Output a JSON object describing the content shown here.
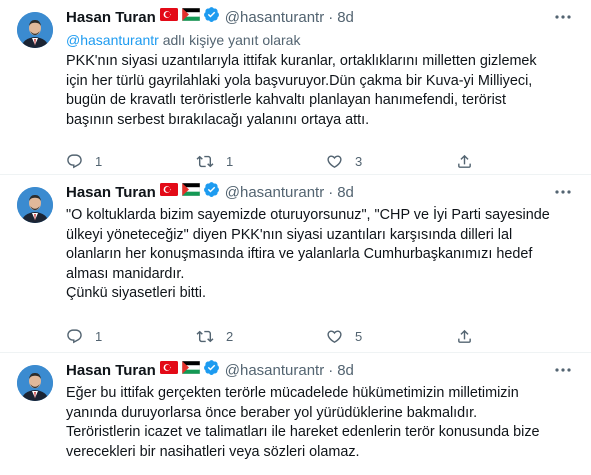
{
  "tweets": [
    {
      "name": "Hasan Turan",
      "handle": "@hasanturantr",
      "time": "8d",
      "reply_to_mention": "@hasanturantr",
      "reply_to_suffix": " adlı kişiye yanıt olarak",
      "text_lines": [
        "PKK'nın siyasi uzantılarıyla ittifak kuranlar, ortaklıklarını milletten gizlemek",
        "için her türlü gayrilahlaki yola başvuruyor.Dün çakma bir Kuva-yi Milliyeci,",
        "bugün de kravatlı teröristlerle kahvaltı planlayan hanımefendi, terörist",
        "başının serbest bırakılacağı yalanını ortaya attı."
      ],
      "replies": "1",
      "retweets": "1",
      "likes": "3"
    },
    {
      "name": "Hasan Turan",
      "handle": "@hasanturantr",
      "time": "8d",
      "text_lines": [
        "\"O koltuklarda bizim sayemizde oturuyorsunuz\", \"CHP ve İyi Parti sayesinde",
        "ülkeyi yöneteceğiz\" diyen PKK'nın siyasi uzantıları karşısında dilleri lal",
        "olanların her konuşmasında iftira ve yalanlarla Cumhurbaşkanımızı hedef",
        "alması manidardır.",
        "Çünkü siyasetleri bitti."
      ],
      "replies": "1",
      "retweets": "2",
      "likes": "5"
    },
    {
      "name": "Hasan Turan",
      "handle": "@hasanturantr",
      "time": "8d",
      "text_lines": [
        "Eğer bu ittifak gerçekten terörle mücadelede hükümetimizin milletimizin",
        "yanında duruyorlarsa önce beraber yol yürüdüklerine bakmalıdır.",
        "Teröristlerin icazet ve talimatları ile hareket edenlerin terör konusunda bize",
        "verecekleri bir nasihatleri veya sözleri olamaz."
      ]
    }
  ],
  "dot_separator": "·",
  "colors": {
    "text": "#0f1419",
    "secondary": "#536471",
    "link": "#1d9bf0",
    "verified": "#1d9bf0",
    "divider": "#eff3f4"
  },
  "icons": [
    "turkey-flag-icon",
    "palestine-flag-icon",
    "verified-badge-icon",
    "more-icon",
    "reply-icon",
    "retweet-icon",
    "like-icon",
    "share-icon"
  ]
}
